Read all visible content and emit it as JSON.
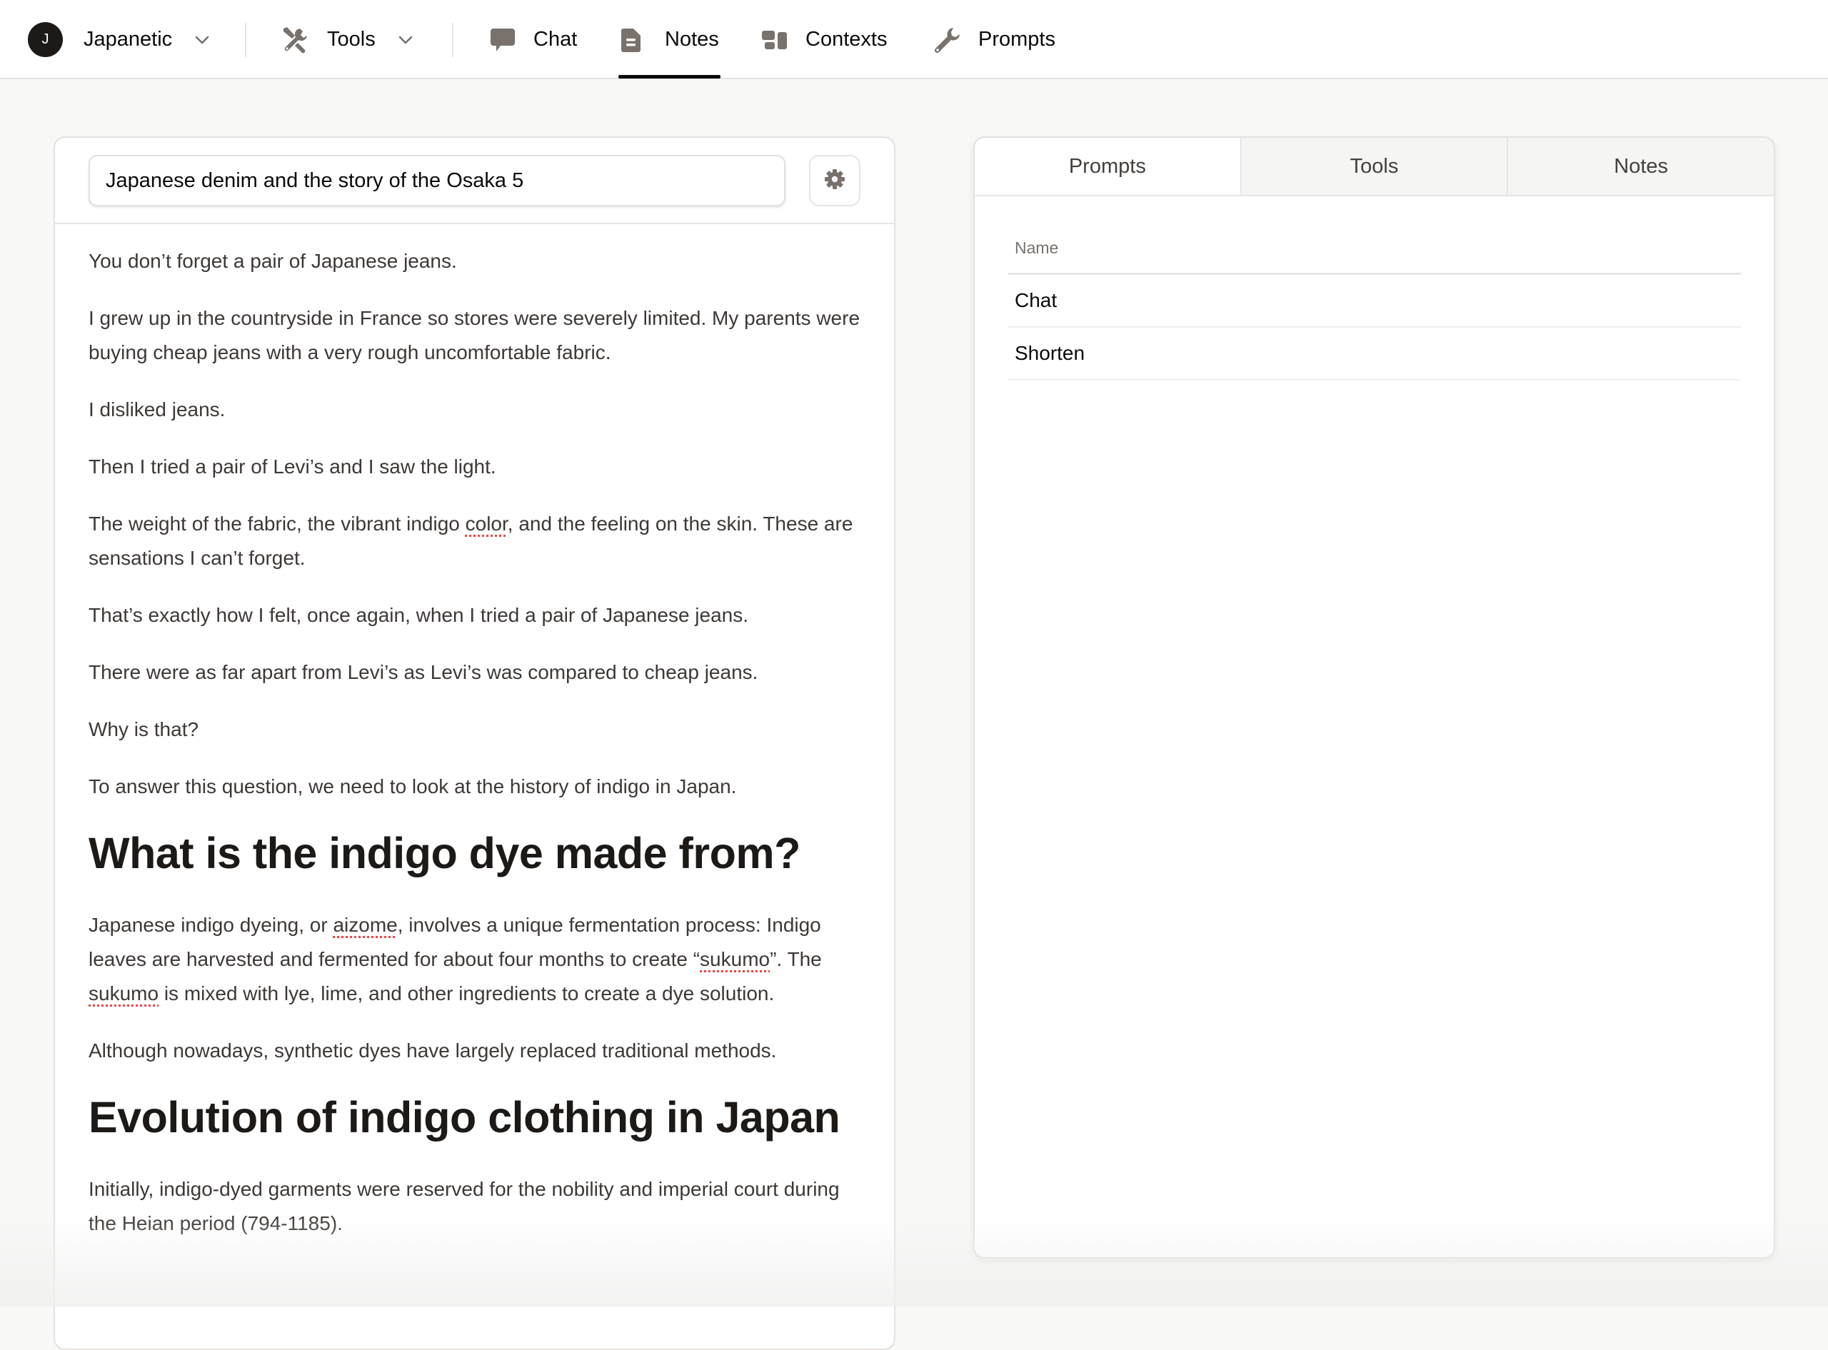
{
  "nav": {
    "workspace": {
      "avatar_letter": "J",
      "name": "Japanetic",
      "icon": "chevron-down-icon"
    },
    "tools": {
      "label": "Tools",
      "icon": "tools-icon"
    },
    "items": [
      {
        "label": "Chat",
        "icon": "chat-bubble-icon",
        "active": false
      },
      {
        "label": "Notes",
        "icon": "document-icon",
        "active": true
      },
      {
        "label": "Contexts",
        "icon": "contexts-icon",
        "active": false
      },
      {
        "label": "Prompts",
        "icon": "wrench-icon",
        "active": false
      }
    ]
  },
  "editor": {
    "title_value": "Japanese denim and the story of the Osaka 5",
    "settings_icon": "gear-icon",
    "content": [
      {
        "type": "p",
        "text": "You don’t forget a pair of Japanese jeans."
      },
      {
        "type": "p",
        "text": "I grew up in the countryside in France so stores were severely limited. My parents were buying cheap jeans with a very rough uncomfortable fabric."
      },
      {
        "type": "p",
        "text": "I disliked jeans."
      },
      {
        "type": "p",
        "text": "Then I tried a pair of Levi’s and I saw the light."
      },
      {
        "type": "p",
        "parts": [
          "The weight of the fabric, the vibrant indigo ",
          "color",
          ", and the feeling on the skin. These are sensations I can’t forget."
        ]
      },
      {
        "type": "p",
        "text": "That’s exactly how I felt, once again, when I tried a pair of Japanese jeans."
      },
      {
        "type": "p",
        "text": "There were as far apart from Levi’s as Levi’s was compared to cheap jeans."
      },
      {
        "type": "p",
        "text": "Why is that?"
      },
      {
        "type": "p",
        "text": "To answer this question, we need to look at the history of indigo in Japan."
      },
      {
        "type": "h2",
        "text": "What is the indigo dye made from?"
      },
      {
        "type": "p",
        "parts": [
          "Japanese indigo dyeing, or ",
          "aizome",
          ", involves a unique fermentation process: Indigo leaves are harvested and fermented for about four months to create “",
          "sukumo",
          "”. The ",
          "sukumo",
          " is mixed with lye, lime, and other ingredients to create a dye solution."
        ]
      },
      {
        "type": "p",
        "text": "Although nowadays, synthetic dyes have largely replaced traditional methods."
      },
      {
        "type": "h2",
        "text": "Evolution of indigo clothing in Japan"
      },
      {
        "type": "p",
        "text": "Initially, indigo-dyed garments were reserved for the nobility and imperial court during the Heian period (794-1185)."
      }
    ]
  },
  "side_panel": {
    "tabs": [
      {
        "label": "Prompts",
        "active": true
      },
      {
        "label": "Tools",
        "active": false
      },
      {
        "label": "Notes",
        "active": false
      }
    ],
    "table": {
      "header": "Name",
      "rows": [
        "Chat",
        "Shorten"
      ]
    }
  },
  "colors": {
    "accent": "#0c0a09",
    "icon_gray": "#78716c",
    "spellcheck": "#ef4444",
    "background": "#f8f8f7"
  }
}
